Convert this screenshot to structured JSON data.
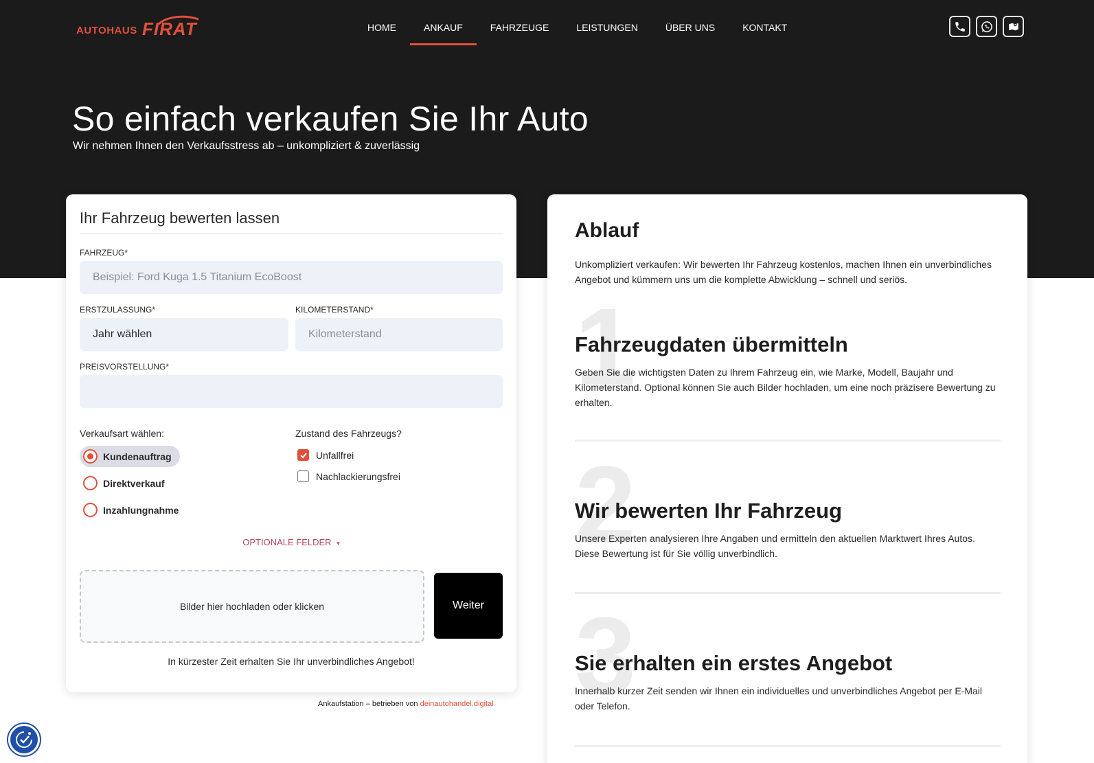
{
  "header": {
    "logo_prefix": "AUTOHAUS",
    "logo_name": "FIRAT",
    "nav": [
      {
        "label": "HOME",
        "active": false
      },
      {
        "label": "ANKAUF",
        "active": true
      },
      {
        "label": "FAHRZEUGE",
        "active": false
      },
      {
        "label": "LEISTUNGEN",
        "active": false
      },
      {
        "label": "ÜBER UNS",
        "active": false
      },
      {
        "label": "KONTAKT",
        "active": false
      }
    ],
    "social": [
      "phone-icon",
      "whatsapp-icon",
      "map-icon"
    ]
  },
  "hero": {
    "title": "So einfach verkaufen Sie Ihr Auto",
    "subtitle": "Wir nehmen Ihnen den Verkaufsstress ab – unkompliziert & zuverlässig"
  },
  "form": {
    "title": "Ihr Fahrzeug bewerten lassen",
    "vehicle": {
      "label": "FAHRZEUG*",
      "placeholder": "Beispiel: Ford Kuga 1.5 Titanium EcoBoost",
      "value": ""
    },
    "registration": {
      "label": "ERSTZULASSUNG*",
      "value": "Jahr wählen"
    },
    "mileage": {
      "label": "KILOMETERSTAND*",
      "placeholder": "Kilometerstand",
      "value": ""
    },
    "price": {
      "label": "PREISVORSTELLUNG*",
      "placeholder": "",
      "value": ""
    },
    "sale_type": {
      "label": "Verkaufsart wählen:",
      "options": [
        "Kundenauftrag",
        "Direktverkauf",
        "Inzahlungnahme"
      ],
      "selected": "Kundenauftrag"
    },
    "condition": {
      "label": "Zustand des Fahrzeugs?",
      "options": [
        {
          "label": "Unfallfrei",
          "checked": true
        },
        {
          "label": "Nachlackierungsfrei",
          "checked": false
        }
      ]
    },
    "optional_fields": "OPTIONALE FELDER",
    "optional_caret": "▾",
    "upload": "Bilder hier hochladen oder klicken",
    "next_button": "Weiter",
    "note": "In kürzester Zeit erhalten Sie Ihr unverbindliches Angebot!"
  },
  "footer": {
    "credit_text": "Ankaufstation – betrieben von",
    "credit_link": "deinautohandel.digital"
  },
  "process": {
    "title": "Ablauf",
    "intro": "Unkompliziert verkaufen: Wir bewerten Ihr Fahrzeug kostenlos, machen Ihnen ein unverbindliches Angebot und kümmern uns um die komplette Abwicklung – schnell und seriös.",
    "steps": [
      {
        "number": "1",
        "title": "Fahrzeugdaten übermitteln",
        "text": "Geben Sie die wichtigsten Daten zu Ihrem Fahrzeug ein, wie Marke, Modell, Baujahr und Kilometerstand. Optional können Sie auch Bilder hochladen, um eine noch präzisere Bewertung zu erhalten."
      },
      {
        "number": "2",
        "title": "Wir bewerten Ihr Fahrzeug",
        "text": "Unsere Experten analysieren Ihre Angaben und ermitteln den aktuellen Marktwert Ihres Autos. Diese Bewertung ist für Sie völlig unverbindlich."
      },
      {
        "number": "3",
        "title": "Sie erhalten ein erstes Angebot",
        "text": "Innerhalb kurzer Zeit senden wir Ihnen ein individuelles und unverbindliches Angebot per E-Mail oder Telefon."
      }
    ]
  },
  "colors": {
    "accent": "#e0503c",
    "dark_bg": "#1c1b1b",
    "input_bg": "#edf1f8",
    "accessibility": "#1f4fa8"
  }
}
